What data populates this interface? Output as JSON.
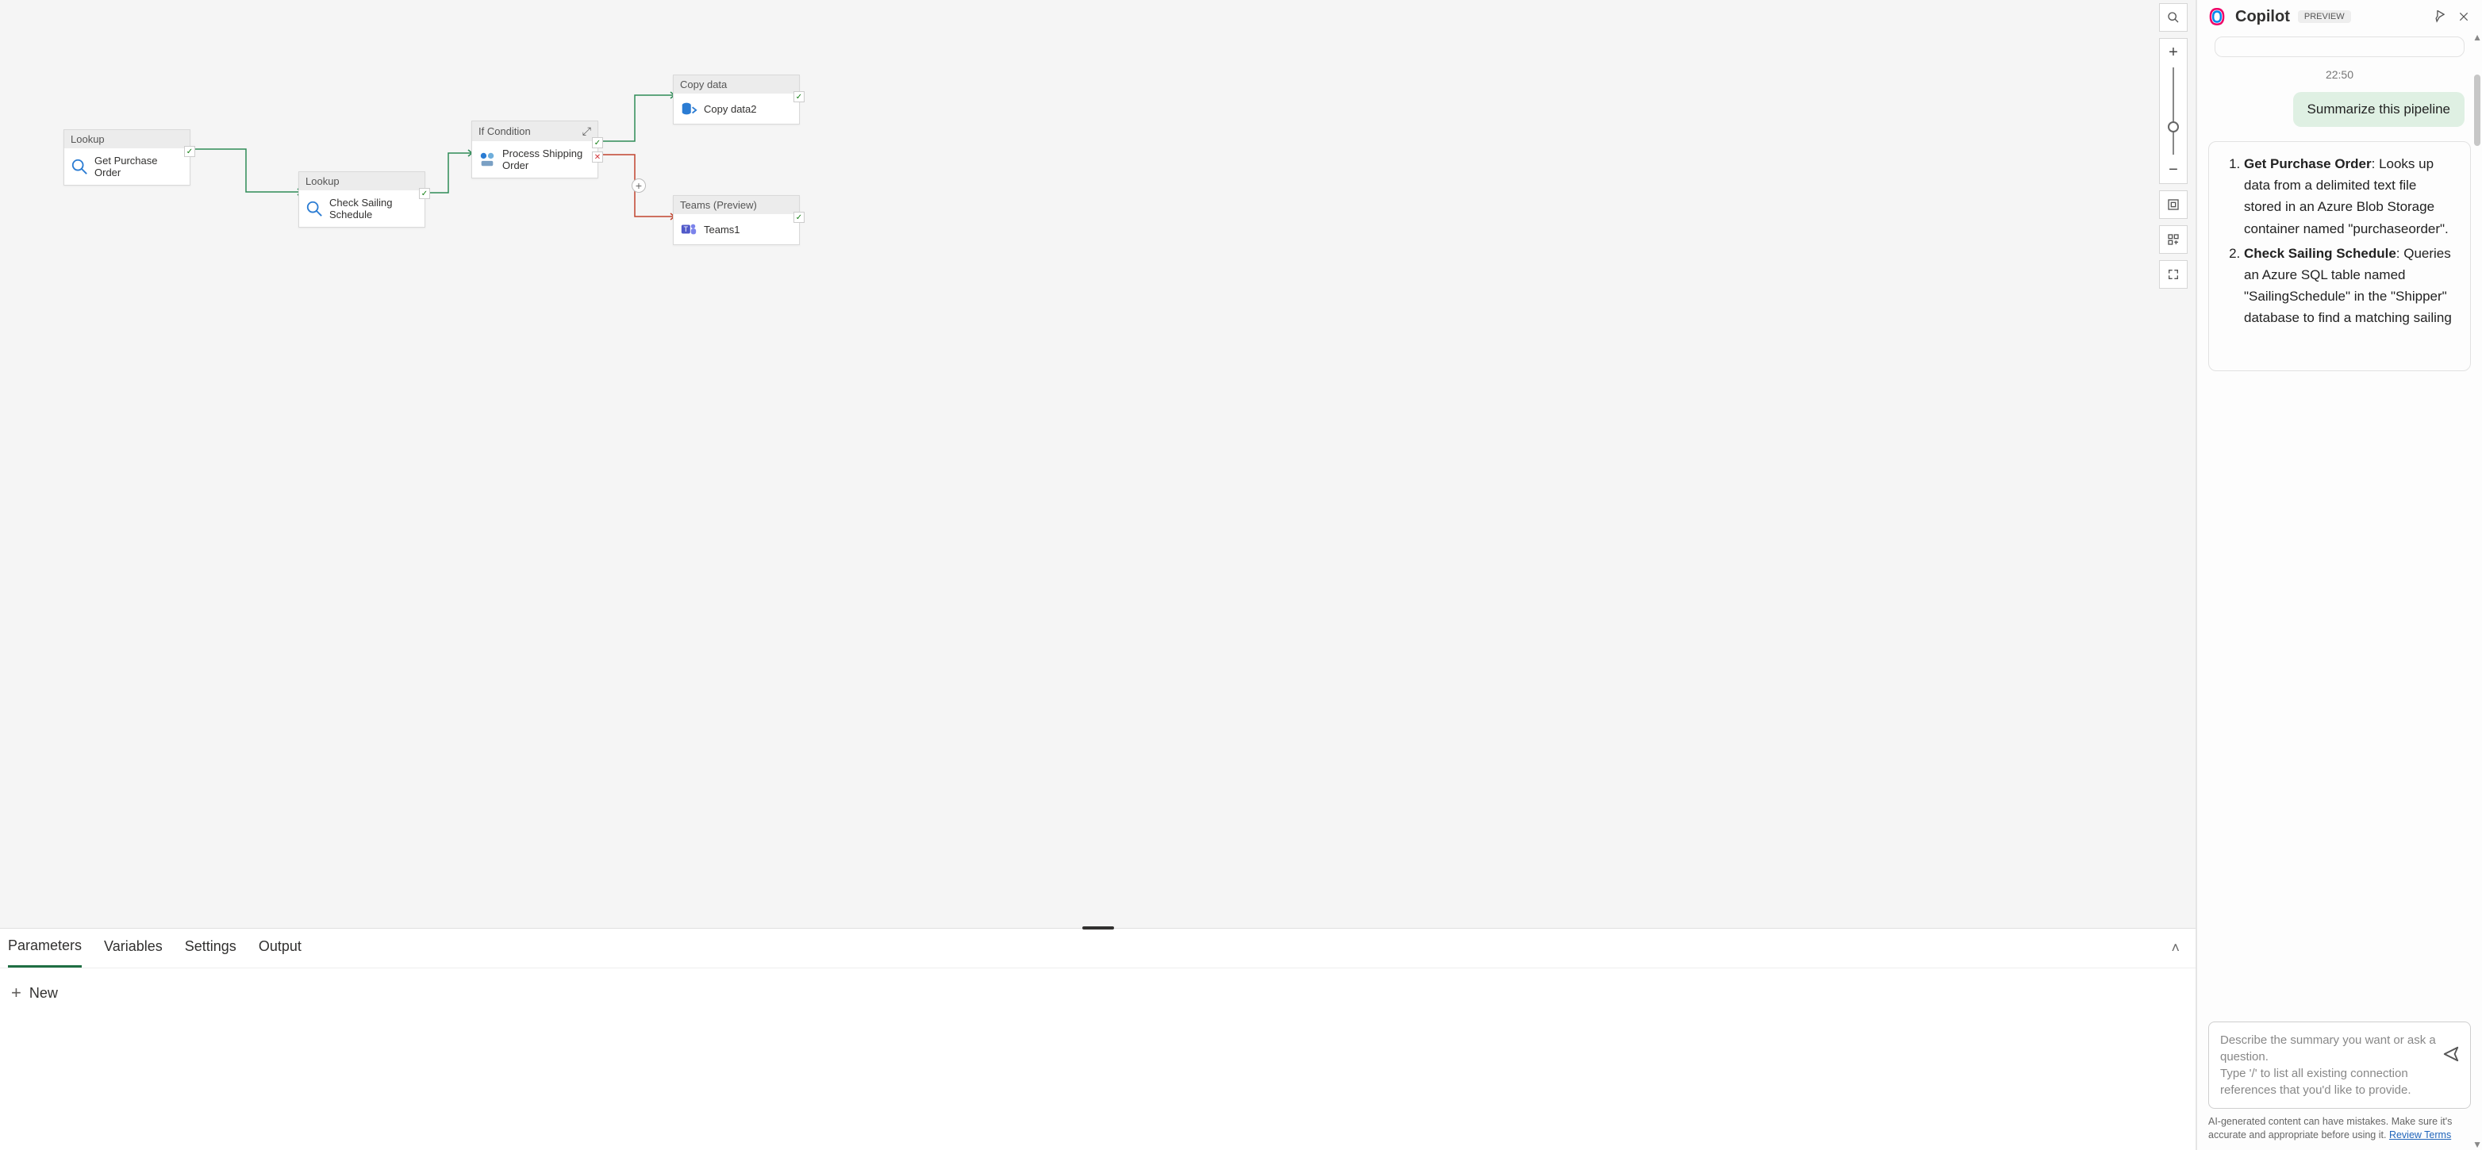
{
  "canvas": {
    "nodes": {
      "lookup1": {
        "type": "Lookup",
        "title": "Get Purchase Order"
      },
      "lookup2": {
        "type": "Lookup",
        "title": "Check Sailing Schedule"
      },
      "ifcond": {
        "type": "If Condition",
        "title": "Process Shipping Order"
      },
      "copy": {
        "type": "Copy data",
        "title": "Copy data2"
      },
      "teams": {
        "type": "Teams (Preview)",
        "title": "Teams1"
      }
    }
  },
  "bottomPanel": {
    "tabs": [
      "Parameters",
      "Variables",
      "Settings",
      "Output"
    ],
    "activeTab": 0,
    "newButton": "New"
  },
  "toolbar": {
    "search": "Search",
    "zoomIn": "+",
    "zoomOut": "−",
    "fit": "Fit to screen",
    "layout": "Auto layout",
    "fullscreen": "Fullscreen"
  },
  "copilot": {
    "title": "Copilot",
    "badge": "PREVIEW",
    "timestamp": "22:50",
    "userMessage": "Summarize this pipeline",
    "assistant": {
      "item1_title": "Get Purchase Order",
      "item1_body": ": Looks up data from a delimited text file stored in an Azure Blob Storage container named \"purchaseorder\".",
      "item2_title": "Check Sailing Schedule",
      "item2_body": ": Queries an Azure SQL table named \"SailingSchedule\" in the \"Shipper\" database to find a matching sailing"
    },
    "input": {
      "placeholder_line1": "Describe the summary you want or ask a question.",
      "placeholder_line2": "Type '/' to list all existing connection references that you'd like to provide."
    },
    "footer_text": "AI-generated content can have mistakes. Make sure it's accurate and appropriate before using it. ",
    "footer_link": "Review Terms"
  }
}
